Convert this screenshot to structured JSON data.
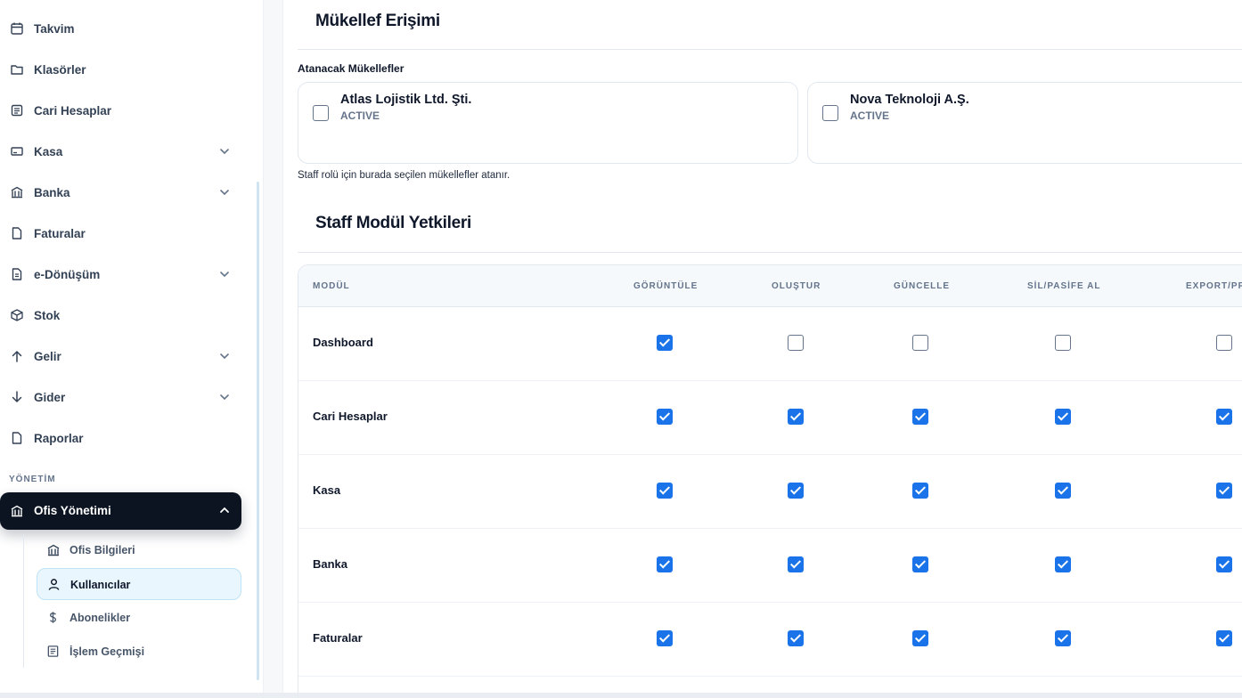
{
  "sidebar": {
    "items": [
      {
        "label": "Takvim",
        "icon": "calendar-icon",
        "has_chevron": false
      },
      {
        "label": "Klasörler",
        "icon": "folder-icon",
        "has_chevron": false
      },
      {
        "label": "Cari Hesaplar",
        "icon": "ledger-icon",
        "has_chevron": false
      },
      {
        "label": "Kasa",
        "icon": "cash-box-icon",
        "has_chevron": true
      },
      {
        "label": "Banka",
        "icon": "bank-icon",
        "has_chevron": true
      },
      {
        "label": "Faturalar",
        "icon": "document-icon",
        "has_chevron": false
      },
      {
        "label": "e-Dönüşüm",
        "icon": "e-document-icon",
        "has_chevron": true
      },
      {
        "label": "Stok",
        "icon": "box-icon",
        "has_chevron": false
      },
      {
        "label": "Gelir",
        "icon": "arrow-up-icon",
        "has_chevron": true
      },
      {
        "label": "Gider",
        "icon": "arrow-down-icon",
        "has_chevron": true
      },
      {
        "label": "Raporlar",
        "icon": "document-icon",
        "has_chevron": false
      }
    ],
    "section_title": "YÖNETİM",
    "active_parent": {
      "label": "Ofis Yönetimi",
      "icon": "bank-icon"
    },
    "sub_items": [
      {
        "label": "Ofis Bilgileri",
        "icon": "bank-icon",
        "active": false
      },
      {
        "label": "Kullanıcılar",
        "icon": "user-icon",
        "active": true
      },
      {
        "label": "Abonelikler",
        "icon": "dollar-icon",
        "active": false
      },
      {
        "label": "İşlem Geçmişi",
        "icon": "history-list-icon",
        "active": false
      }
    ]
  },
  "access": {
    "title": "Mükellef Erişimi",
    "assign_label": "Atanacak Mükellefler",
    "taxpayers": [
      {
        "name": "Atlas Lojistik Ltd. Şti.",
        "status": "ACTIVE",
        "checked": false
      },
      {
        "name": "Nova Teknoloji A.Ş.",
        "status": "ACTIVE",
        "checked": false
      }
    ],
    "helper": "Staff rolü için burada seçilen mükellefler atanır."
  },
  "permissions": {
    "title": "Staff Modül Yetkileri",
    "columns": [
      "MODÜL",
      "GÖRÜNTÜLE",
      "OLUŞTUR",
      "GÜNCELLE",
      "SİL/PASİFE AL",
      "EXPORT/PR"
    ],
    "rows": [
      {
        "module": "Dashboard",
        "values": [
          true,
          false,
          false,
          false,
          false
        ]
      },
      {
        "module": "Cari Hesaplar",
        "values": [
          true,
          true,
          true,
          true,
          true
        ]
      },
      {
        "module": "Kasa",
        "values": [
          true,
          true,
          true,
          true,
          true
        ]
      },
      {
        "module": "Banka",
        "values": [
          true,
          true,
          true,
          true,
          true
        ]
      },
      {
        "module": "Faturalar",
        "values": [
          true,
          true,
          true,
          true,
          true
        ]
      }
    ]
  },
  "colors": {
    "accent": "#1a73e8",
    "sidebar_active_bg": "#0b1420",
    "sub_active_bg": "#e9f6fd"
  }
}
